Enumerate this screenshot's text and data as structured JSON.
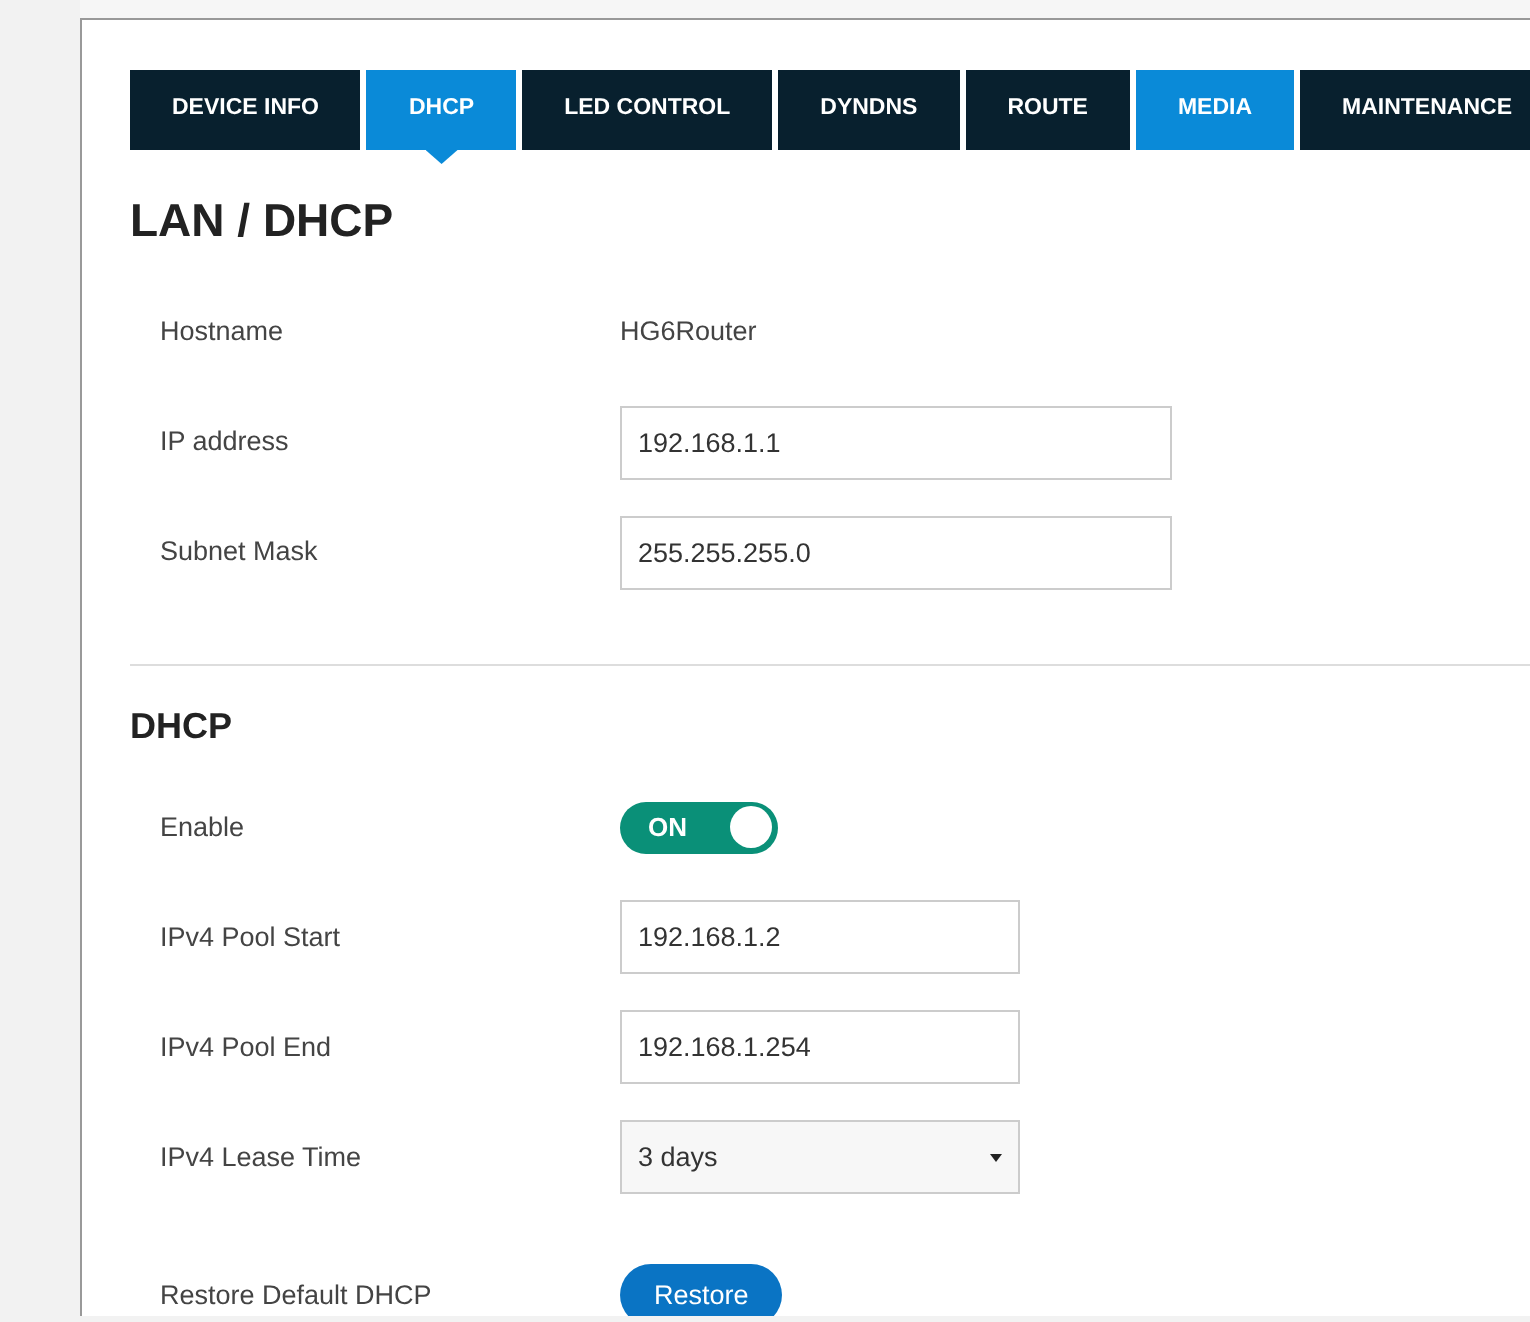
{
  "tabs": [
    {
      "label": "DEVICE INFO",
      "selected": false,
      "highlighted": false
    },
    {
      "label": "DHCP",
      "selected": true,
      "highlighted": true
    },
    {
      "label": "LED CONTROL",
      "selected": false,
      "highlighted": false
    },
    {
      "label": "DYNDNS",
      "selected": false,
      "highlighted": false
    },
    {
      "label": "ROUTE",
      "selected": false,
      "highlighted": false
    },
    {
      "label": "MEDIA",
      "selected": false,
      "highlighted": true
    },
    {
      "label": "MAINTENANCE",
      "selected": false,
      "highlighted": false
    }
  ],
  "sections": [
    {
      "title": "LAN / DHCP",
      "large": true,
      "rows": [
        {
          "kind": "text",
          "label": "Hostname",
          "value": "HG6Router"
        },
        {
          "kind": "input",
          "label": "IP address",
          "value": "192.168.1.1",
          "wide": true
        },
        {
          "kind": "input",
          "label": "Subnet Mask",
          "value": "255.255.255.0",
          "wide": true
        }
      ]
    },
    {
      "title": "DHCP",
      "large": false,
      "rows": [
        {
          "kind": "toggle",
          "label": "Enable",
          "value": "ON",
          "on": true
        },
        {
          "kind": "input",
          "label": "IPv4 Pool Start",
          "value": "192.168.1.2",
          "wide": false
        },
        {
          "kind": "input",
          "label": "IPv4 Pool End",
          "value": "192.168.1.254",
          "wide": false
        },
        {
          "kind": "select",
          "label": "IPv4 Lease Time",
          "value": "3 days"
        },
        {
          "kind": "button",
          "label": "Restore Default DHCP",
          "value": "Restore"
        }
      ]
    }
  ]
}
